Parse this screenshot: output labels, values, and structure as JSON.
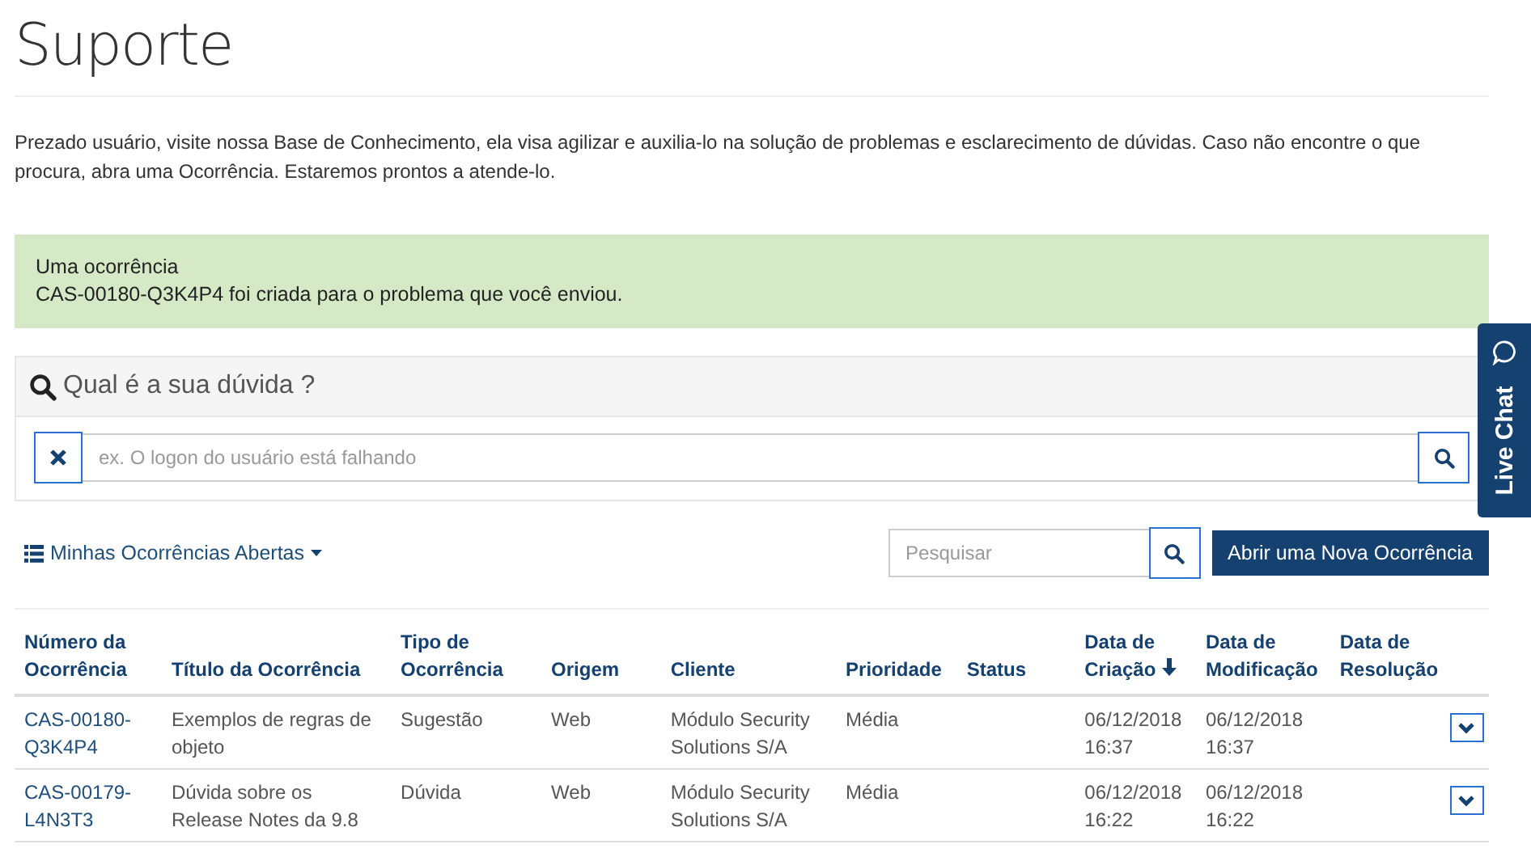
{
  "page_title": "Suporte",
  "intro": "Prezado usuário, visite nossa Base de Conhecimento, ela visa agilizar e auxilia-lo na solução de problemas e esclarecimento de dúvidas. Caso não encontre o que procura, abra uma Ocorrência. Estaremos prontos a atende-lo.",
  "alert": {
    "heading": "Uma ocorrência",
    "message": "CAS-00180-Q3K4P4 foi criada para o problema que você enviou."
  },
  "kb_search": {
    "title": "Qual é a sua dúvida ?",
    "placeholder": "ex. O logon do usuário está falhando"
  },
  "toolbar": {
    "view_label": "Minhas Ocorrências Abertas",
    "search_placeholder": "Pesquisar",
    "new_button": "Abrir uma Nova Ocorrência"
  },
  "table": {
    "columns": [
      {
        "label": "Número da Ocorrência",
        "sorted": false
      },
      {
        "label": "Título da Ocorrência",
        "sorted": false
      },
      {
        "label": "Tipo de Ocorrência",
        "sorted": false
      },
      {
        "label": "Origem",
        "sorted": false
      },
      {
        "label": "Cliente",
        "sorted": false
      },
      {
        "label": "Prioridade",
        "sorted": false
      },
      {
        "label": "Status",
        "sorted": false
      },
      {
        "label": "Data de Criação",
        "sorted": true
      },
      {
        "label": "Data de Modificação",
        "sorted": false
      },
      {
        "label": "Data de Resolução",
        "sorted": false
      }
    ],
    "rows": [
      {
        "number": "CAS-00180-Q3K4P4",
        "title": "Exemplos de regras de objeto",
        "type": "Sugestão",
        "origin": "Web",
        "client": "Módulo Security Solutions S/A",
        "priority": "Média",
        "created": "06/12/2018 16:37",
        "modified": "06/12/2018 16:37"
      },
      {
        "number": "CAS-00179-L4N3T3",
        "title": "Dúvida sobre os Release Notes da 9.8",
        "type": "Dúvida",
        "origin": "Web",
        "client": "Módulo Security Solutions S/A",
        "priority": "Média",
        "created": "06/12/2018 16:22",
        "modified": "06/12/2018 16:22"
      }
    ]
  },
  "live_chat": "Live Chat"
}
